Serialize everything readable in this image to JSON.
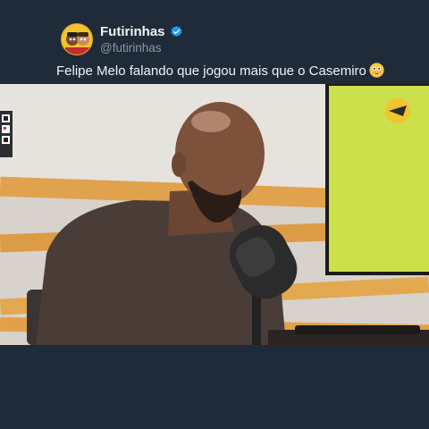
{
  "post": {
    "display_name": "Futirinhas",
    "handle": "@futirinhas",
    "verified": true,
    "caption": "Felipe Melo falando que jogou mais que o Casemiro",
    "caption_emoji": "flushed-face-emoji"
  },
  "colors": {
    "background": "#1f2b38",
    "verified_badge": "#1d9bf0",
    "handle": "#8b98a5",
    "screen_green": "#cbe04a",
    "tape_orange": "#e0a24c"
  },
  "video": {
    "icons": [
      "qr-code-icon",
      "channel-logo-icon",
      "microphone"
    ]
  }
}
